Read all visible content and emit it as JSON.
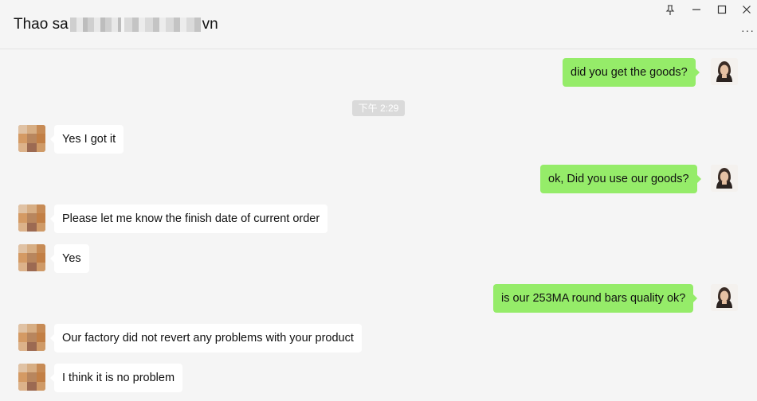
{
  "header": {
    "title_start": "Thao sa",
    "title_end": "vn",
    "pin_label": "⊥",
    "minimize_label": "—",
    "maximize_label": "☐",
    "close_label": "✕",
    "more_label": "···"
  },
  "chat": {
    "timestamp": "下午 2:29",
    "messages": [
      {
        "from": "me",
        "text": "did you get the goods?"
      },
      {
        "from": "peer",
        "text": "Yes I got it"
      },
      {
        "from": "me",
        "text": "ok, Did you use our goods?"
      },
      {
        "from": "peer",
        "text": "Please let me know the finish date of current order"
      },
      {
        "from": "peer",
        "text": "Yes"
      },
      {
        "from": "me",
        "text": "is our 253MA round bars quality ok?"
      },
      {
        "from": "peer",
        "text": "Our factory did not revert any problems with your product"
      },
      {
        "from": "peer",
        "text": "I think it is no problem"
      }
    ]
  },
  "colors": {
    "outgoing_bubble": "#95ec69",
    "incoming_bubble": "#ffffff",
    "background": "#f5f5f5",
    "timestamp_bg": "#dadada"
  }
}
